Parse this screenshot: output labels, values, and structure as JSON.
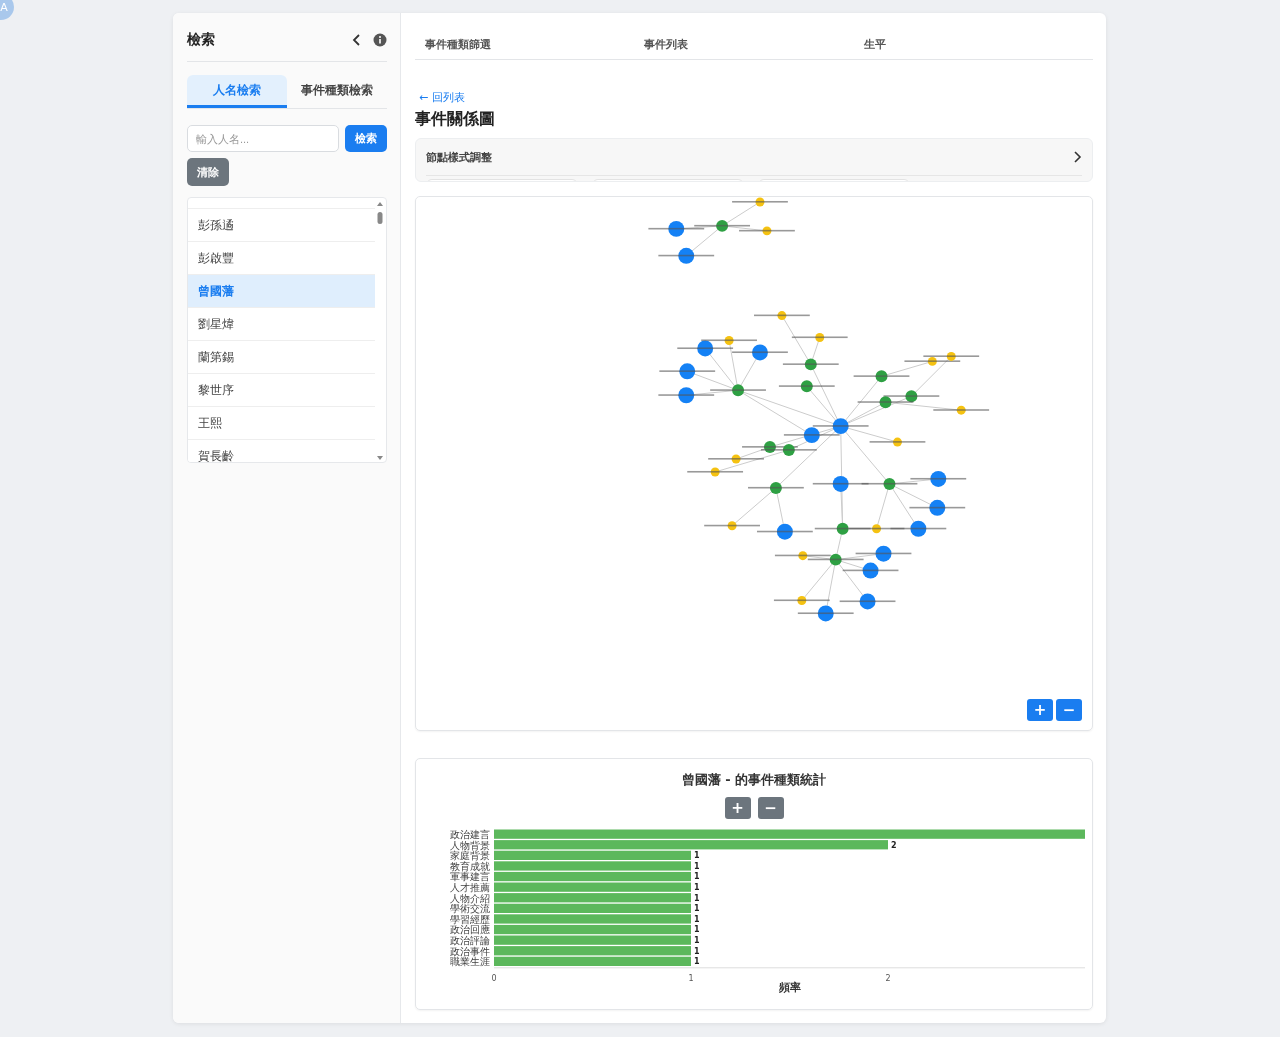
{
  "avatar": {
    "initial": "A"
  },
  "sidebar": {
    "title": "檢索",
    "tabs": [
      {
        "label": "人名檢索",
        "selected": true
      },
      {
        "label": "事件種類檢索",
        "selected": false
      }
    ],
    "search": {
      "placeholder": "輸入人名...",
      "button": "檢索"
    },
    "clear_button": "清除",
    "people": [
      {
        "name": "彭孫遹",
        "selected": false
      },
      {
        "name": "彭啟豐",
        "selected": false
      },
      {
        "name": "曾國藩",
        "selected": true
      },
      {
        "name": "劉星煒",
        "selected": false
      },
      {
        "name": "蘭第錫",
        "selected": false
      },
      {
        "name": "黎世序",
        "selected": false
      },
      {
        "name": "王熙",
        "selected": false
      },
      {
        "name": "賀長齡",
        "selected": false
      }
    ]
  },
  "main_tabs": [
    {
      "label": "事件種類篩選"
    },
    {
      "label": "事件列表"
    },
    {
      "label": "生平"
    }
  ],
  "back_link": "← 回列表",
  "heading": "事件關係圖",
  "style_panel": {
    "title": "節點樣式調整",
    "expanded": false
  },
  "graph": {
    "zoom_in": "+",
    "zoom_out": "−"
  },
  "stats": {
    "title": "曾國藩 - 的事件種類統計",
    "zoom_in": "+",
    "zoom_out": "−",
    "chart_data": {
      "type": "bar",
      "orientation": "horizontal",
      "xlabel": "頻率",
      "categories": [
        "政治建言",
        "人物背景",
        "家庭背景",
        "教育成就",
        "軍事建言",
        "人才推薦",
        "人物介紹",
        "學術交流",
        "學習經歷",
        "政治回應",
        "政治評論",
        "政治事件",
        "職業生涯"
      ],
      "series": [
        {
          "color": "#5cb85c",
          "values": [
            3,
            2,
            1,
            1,
            1,
            1,
            1,
            1,
            1,
            1,
            1,
            1,
            1
          ]
        }
      ],
      "xlim": [
        0,
        3
      ],
      "xticks": [
        0,
        1,
        2
      ],
      "value_labels": [
        null,
        "2",
        "1",
        "1",
        "1",
        "1",
        "1",
        "1",
        "1",
        "1",
        "1",
        "1",
        "1"
      ]
    }
  }
}
